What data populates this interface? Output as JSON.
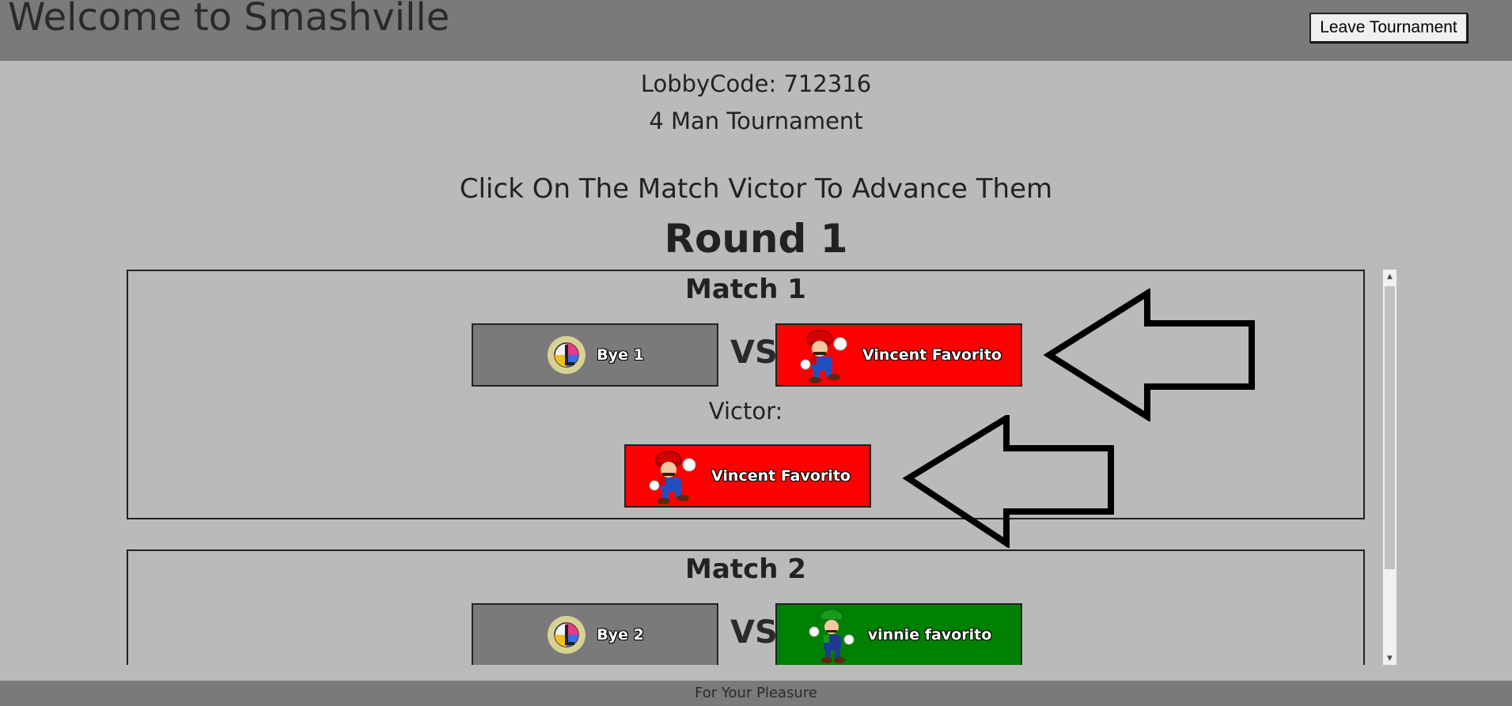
{
  "header": {
    "title": "Welcome to Smashville",
    "leave_button": "Leave Tournament"
  },
  "lobby_code": "LobbyCode: 712316",
  "tournament_size": "4 Man Tournament",
  "instruction": "Click On The Match Victor To Advance Them",
  "round_title": "Round 1",
  "matches": [
    {
      "title": "Match 1",
      "player1": {
        "name": "Bye 1",
        "icon": "smash-ball-icon",
        "color": "#7a7a7a"
      },
      "vs": "VS",
      "player2": {
        "name": "Vincent Favorito",
        "icon": "mario-icon",
        "color": "#ff0000"
      },
      "victor_label": "Victor:",
      "victor": {
        "name": "Vincent Favorito",
        "icon": "mario-icon",
        "color": "#ff0000"
      }
    },
    {
      "title": "Match 2",
      "player1": {
        "name": "Bye 2",
        "icon": "smash-ball-icon",
        "color": "#7a7a7a"
      },
      "vs": "VS",
      "player2": {
        "name": "vinnie favorito",
        "icon": "luigi-icon",
        "color": "#008000"
      }
    }
  ],
  "footer": "For Your Pleasure"
}
